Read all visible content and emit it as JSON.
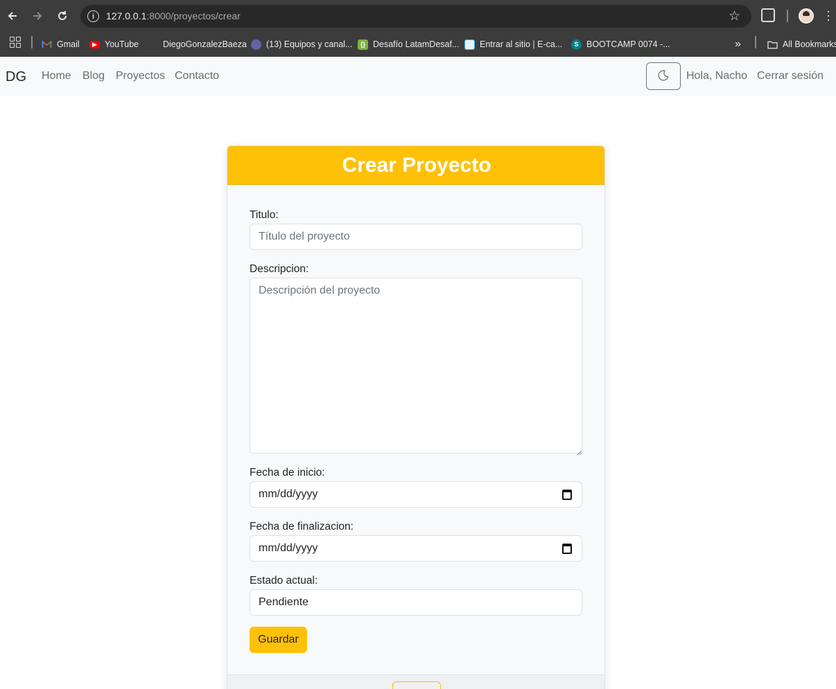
{
  "browser": {
    "url_host": "127.0.0.1",
    "url_rest": ":8000/proyectos/crear",
    "bookmarks": [
      {
        "label": "Gmail",
        "icon": "gmail-icon",
        "color": "#ea4335"
      },
      {
        "label": "YouTube",
        "icon": "youtube-icon",
        "color": "#ff0000"
      },
      {
        "label": "DiegoGonzalezBaeza",
        "icon": "",
        "color": ""
      },
      {
        "label": "(13) Equipos y canal...",
        "icon": "teams-icon",
        "color": "#6264a7"
      },
      {
        "label": "Desafío LatamDesaf...",
        "icon": "desafio-icon",
        "color": "#7cb342"
      },
      {
        "label": "Entrar al sitio | E-ca...",
        "icon": "ecampus-icon",
        "color": "#29b6f6"
      },
      {
        "label": "BOOTCAMP 0074 -...",
        "icon": "sharepoint-icon",
        "color": "#038387"
      }
    ],
    "all_bookmarks": "All Bookmarks",
    "more_bookmarks": "»"
  },
  "navbar": {
    "brand": "DG",
    "links": [
      "Home",
      "Blog",
      "Proyectos",
      "Contacto"
    ],
    "greeting": "Hola, Nacho",
    "logout": "Cerrar sesión"
  },
  "form": {
    "title": "Crear Proyecto",
    "titulo_label": "Titulo:",
    "titulo_placeholder": "Título del proyecto",
    "descripcion_label": "Descripcion:",
    "descripcion_placeholder": "Descripción del proyecto",
    "fecha_inicio_label": "Fecha de inicio:",
    "fecha_inicio_value": "mm/dd/yyyy",
    "fecha_fin_label": "Fecha de finalizacion:",
    "fecha_fin_value": "mm/dd/yyyy",
    "estado_label": "Estado actual:",
    "estado_value": "Pendiente",
    "save_label": "Guardar"
  }
}
